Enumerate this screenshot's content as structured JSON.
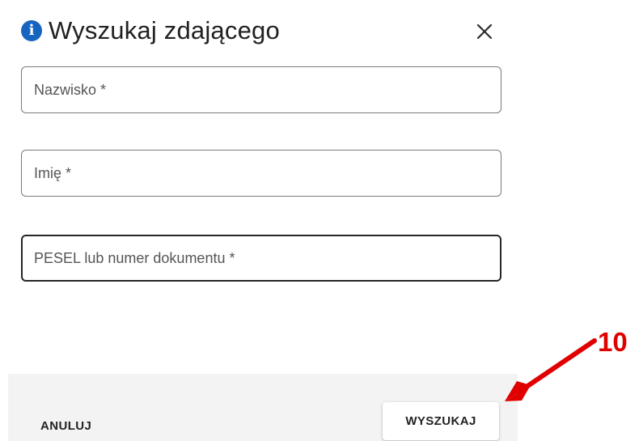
{
  "dialog": {
    "title": "Wyszukaj zdającego",
    "info_icon_glyph": "i",
    "close_icon": "close-icon",
    "accent_color": "#1565c0"
  },
  "form": {
    "fields": [
      {
        "placeholder": "Nazwisko *",
        "value": ""
      },
      {
        "placeholder": "Imię *",
        "value": ""
      },
      {
        "placeholder": "PESEL lub numer dokumentu *",
        "value": "",
        "focused": true
      }
    ]
  },
  "footer": {
    "cancel_label": "ANULUJ",
    "search_label": "WYSZUKAJ"
  },
  "annotation": {
    "number": "10",
    "color": "#e00000"
  }
}
